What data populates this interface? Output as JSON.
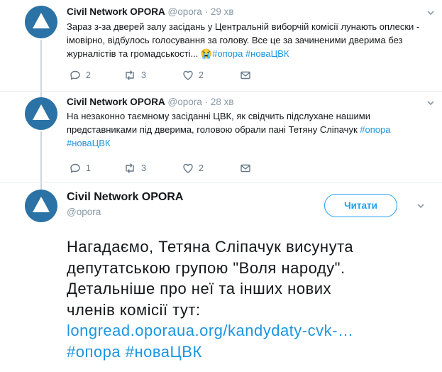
{
  "tweets": [
    {
      "name": "Civil Network OPORA",
      "handle": "@opora",
      "separator": "·",
      "time": "29 хв",
      "text": "Зараз з-за дверей залу засідань у Центральній виборчій комісії лунають оплески - імовірно, відбулось голосування за голову. Все це за зачиненими дверима без журналістів та громадськості...",
      "emoji": "😭",
      "hashtags": [
        "#опора",
        "#новаЦВК"
      ],
      "replies": "2",
      "retweets": "3",
      "likes": "2"
    },
    {
      "name": "Civil Network OPORA",
      "handle": "@opora",
      "separator": "·",
      "time": "28 хв",
      "text": "На незаконно таємному засіданні ЦВК, як свідчить підслухане нашими представниками під дверима, головою обрали пані Тетяну Сліпачук",
      "hashtags": [
        "#опора",
        "#новаЦВК"
      ],
      "replies": "1",
      "retweets": "3",
      "likes": "2"
    }
  ],
  "main_tweet": {
    "name": "Civil Network OPORA",
    "handle": "@opora",
    "follow_label": "Читати",
    "lines": [
      "Нагадаємо, Тетяна Сліпачук висунута",
      "депутатською групою \"Воля народу\".",
      "Детальніше про неї та інших нових",
      "членів комісії тут:"
    ],
    "link": "longread.oporaua.org/kandydaty-cvk-…",
    "hashtags": [
      "#опора",
      "#новаЦВК"
    ]
  },
  "colors": {
    "brand": "#2b72a6",
    "link": "#1b95e0",
    "follow": "#1da1f2",
    "muted": "#657786"
  }
}
